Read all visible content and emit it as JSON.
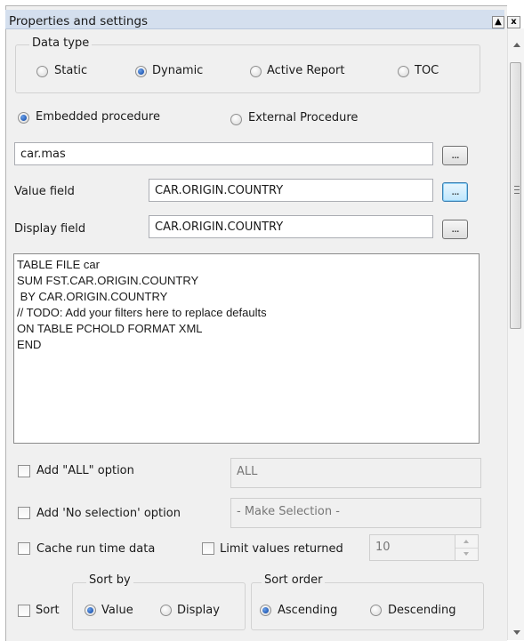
{
  "panel": {
    "title": "Properties and settings",
    "title_buttons": {
      "pin": "▲",
      "close": "x"
    }
  },
  "data_type": {
    "legend": "Data type",
    "options": [
      {
        "label": "Static",
        "selected": false
      },
      {
        "label": "Dynamic",
        "selected": true
      },
      {
        "label": "Active Report",
        "selected": false
      },
      {
        "label": "TOC",
        "selected": false
      }
    ]
  },
  "procedure": {
    "options": [
      {
        "label": "Embedded procedure",
        "selected": true
      },
      {
        "label": "External Procedure",
        "selected": false
      }
    ],
    "master_file": "car.mas",
    "browse_label": "..."
  },
  "value_field": {
    "label": "Value field",
    "value": "CAR.ORIGIN.COUNTRY"
  },
  "display_field": {
    "label": "Display field",
    "value": "CAR.ORIGIN.COUNTRY"
  },
  "code": "TABLE FILE car\nSUM FST.CAR.ORIGIN.COUNTRY\n BY CAR.ORIGIN.COUNTRY\n// TODO: Add your filters here to replace defaults\nON TABLE PCHOLD FORMAT XML\nEND",
  "options": {
    "add_all": {
      "label": "Add \"ALL\" option",
      "checked": false,
      "value": "ALL"
    },
    "add_no_selection": {
      "label": "Add 'No selection' option",
      "checked": false,
      "value": "- Make Selection -"
    },
    "cache_run_time": {
      "label": "Cache run time data",
      "checked": false
    },
    "limit_values": {
      "label": "Limit values returned",
      "checked": false,
      "value": "10"
    }
  },
  "sort": {
    "checkbox_label": "Sort",
    "checked": false,
    "sort_by": {
      "legend": "Sort by",
      "options": [
        {
          "label": "Value",
          "selected": true
        },
        {
          "label": "Display",
          "selected": false
        }
      ]
    },
    "sort_order": {
      "legend": "Sort order",
      "options": [
        {
          "label": "Ascending",
          "selected": true
        },
        {
          "label": "Descending",
          "selected": false
        }
      ]
    }
  }
}
